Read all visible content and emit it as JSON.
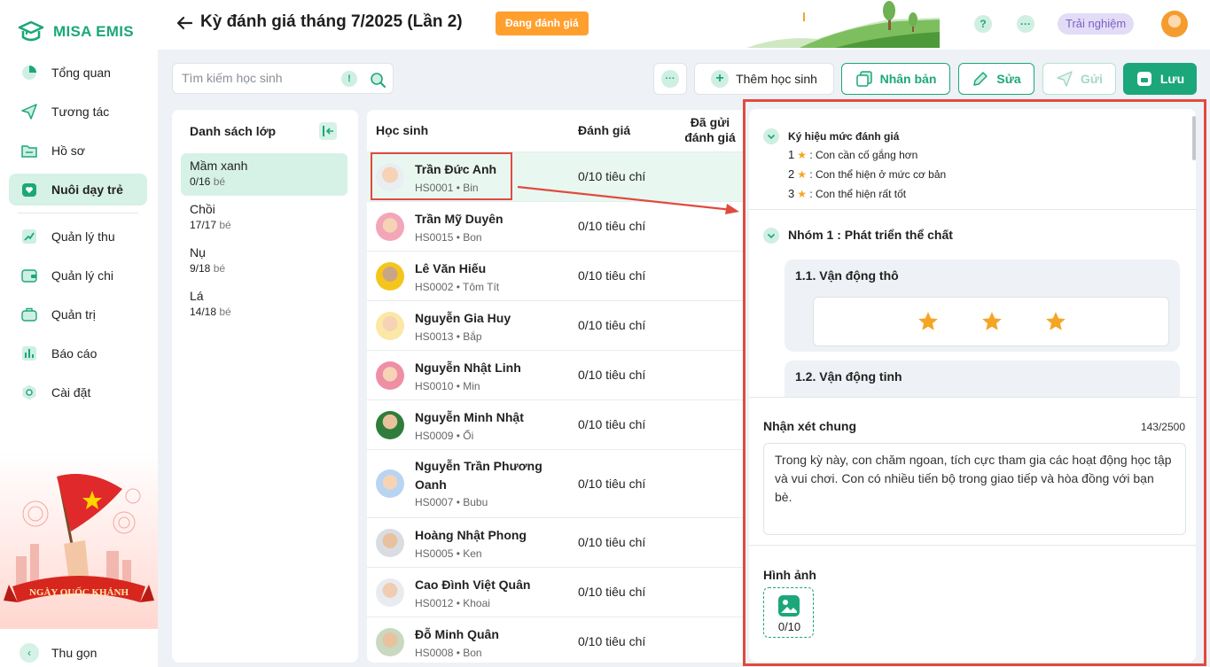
{
  "brand": {
    "name": "MISA EMIS",
    "color": "#1ba77a"
  },
  "nav": {
    "items": [
      {
        "label": "Tổng quan",
        "icon": "pie-chart-icon"
      },
      {
        "label": "Tương tác",
        "icon": "send-icon"
      },
      {
        "label": "Hồ sơ",
        "icon": "folder-icon"
      },
      {
        "label": "Nuôi dạy trẻ",
        "icon": "heart-icon",
        "active": true
      },
      {
        "label": "Quản lý thu",
        "icon": "trend-icon"
      },
      {
        "label": "Quản lý chi",
        "icon": "wallet-icon"
      },
      {
        "label": "Quản trị",
        "icon": "briefcase-icon"
      },
      {
        "label": "Báo cáo",
        "icon": "bar-chart-icon"
      },
      {
        "label": "Cài đặt",
        "icon": "settings-icon"
      }
    ],
    "collapse_label": "Thu gọn",
    "promo_text": "NGÀY QUỐC KHÁNH"
  },
  "header": {
    "title": "Kỳ đánh giá tháng 7/2025 (Lần 2)",
    "status": "Đang đánh giá",
    "help": "?",
    "more": "···",
    "trial": "Trải nghiệm"
  },
  "toolbar": {
    "search_placeholder": "Tìm kiếm học sinh",
    "search_info": "!",
    "more": "···",
    "add": "Thêm học sinh",
    "duplicate": "Nhân bản",
    "edit": "Sửa",
    "send": "Gửi",
    "save": "Lưu"
  },
  "classes": {
    "title": "Danh sách lớp",
    "unit": "bé",
    "items": [
      {
        "name": "Mầm xanh",
        "count": "0/16",
        "active": true
      },
      {
        "name": "Chồi",
        "count": "17/17"
      },
      {
        "name": "Nụ",
        "count": "9/18"
      },
      {
        "name": "Lá",
        "count": "14/18"
      }
    ]
  },
  "students": {
    "columns": [
      "Học sinh",
      "Đánh giá",
      "Đã gửi đánh giá"
    ],
    "rows": [
      {
        "name": "Trần Đức Anh",
        "code": "HS0001 • Bin",
        "eval": "0/10 tiêu chí",
        "selected": true
      },
      {
        "name": "Trần Mỹ Duyên",
        "code": "HS0015 • Bon",
        "eval": "0/10 tiêu chí"
      },
      {
        "name": "Lê Văn Hiếu",
        "code": "HS0002 • Tôm Tít",
        "eval": "0/10 tiêu chí"
      },
      {
        "name": "Nguyễn Gia Huy",
        "code": "HS0013 • Bắp",
        "eval": "0/10 tiêu chí"
      },
      {
        "name": "Nguyễn Nhật Linh",
        "code": "HS0010 • Min",
        "eval": "0/10 tiêu chí"
      },
      {
        "name": "Nguyễn Minh Nhật",
        "code": "HS0009 • Ổi",
        "eval": "0/10 tiêu chí"
      },
      {
        "name": "Nguyễn Trần Phương Oanh",
        "code": "HS0007 • Bubu",
        "eval": "0/10 tiêu chí"
      },
      {
        "name": "Hoàng Nhật Phong",
        "code": "HS0005 • Ken",
        "eval": "0/10 tiêu chí"
      },
      {
        "name": "Cao Đình Việt Quân",
        "code": "HS0012 • Khoai",
        "eval": "0/10 tiêu chí"
      },
      {
        "name": "Đỗ Minh Quân",
        "code": "HS0008 • Bon",
        "eval": "0/10 tiêu chí"
      }
    ]
  },
  "evaluation": {
    "legend_title": "Ký hiệu mức đánh giá",
    "legend": [
      {
        "num": "1",
        "text": ": Con cần cố gắng hơn"
      },
      {
        "num": "2",
        "text": ": Con thể hiện ở mức cơ bản"
      },
      {
        "num": "3",
        "text": ": Con thể hiện rất tốt"
      }
    ],
    "group_title": "Nhóm 1 : Phát triển thể chất",
    "criteria": [
      {
        "title": "1.1. Vận động thô",
        "stars": 3
      },
      {
        "title": "1.2. Vận động tinh"
      }
    ],
    "comment_label": "Nhận xét chung",
    "comment_count": "143/2500",
    "comment_text": "Trong kỳ này, con chăm ngoan, tích cực tham gia các hoạt động học tập và vui chơi. Con có nhiều tiến bộ trong giao tiếp và hòa đồng với bạn bè.",
    "image_label": "Hình ảnh",
    "image_count": "0/10",
    "star_color": "#f5a524",
    "highlight_color": "#e04b3f"
  }
}
